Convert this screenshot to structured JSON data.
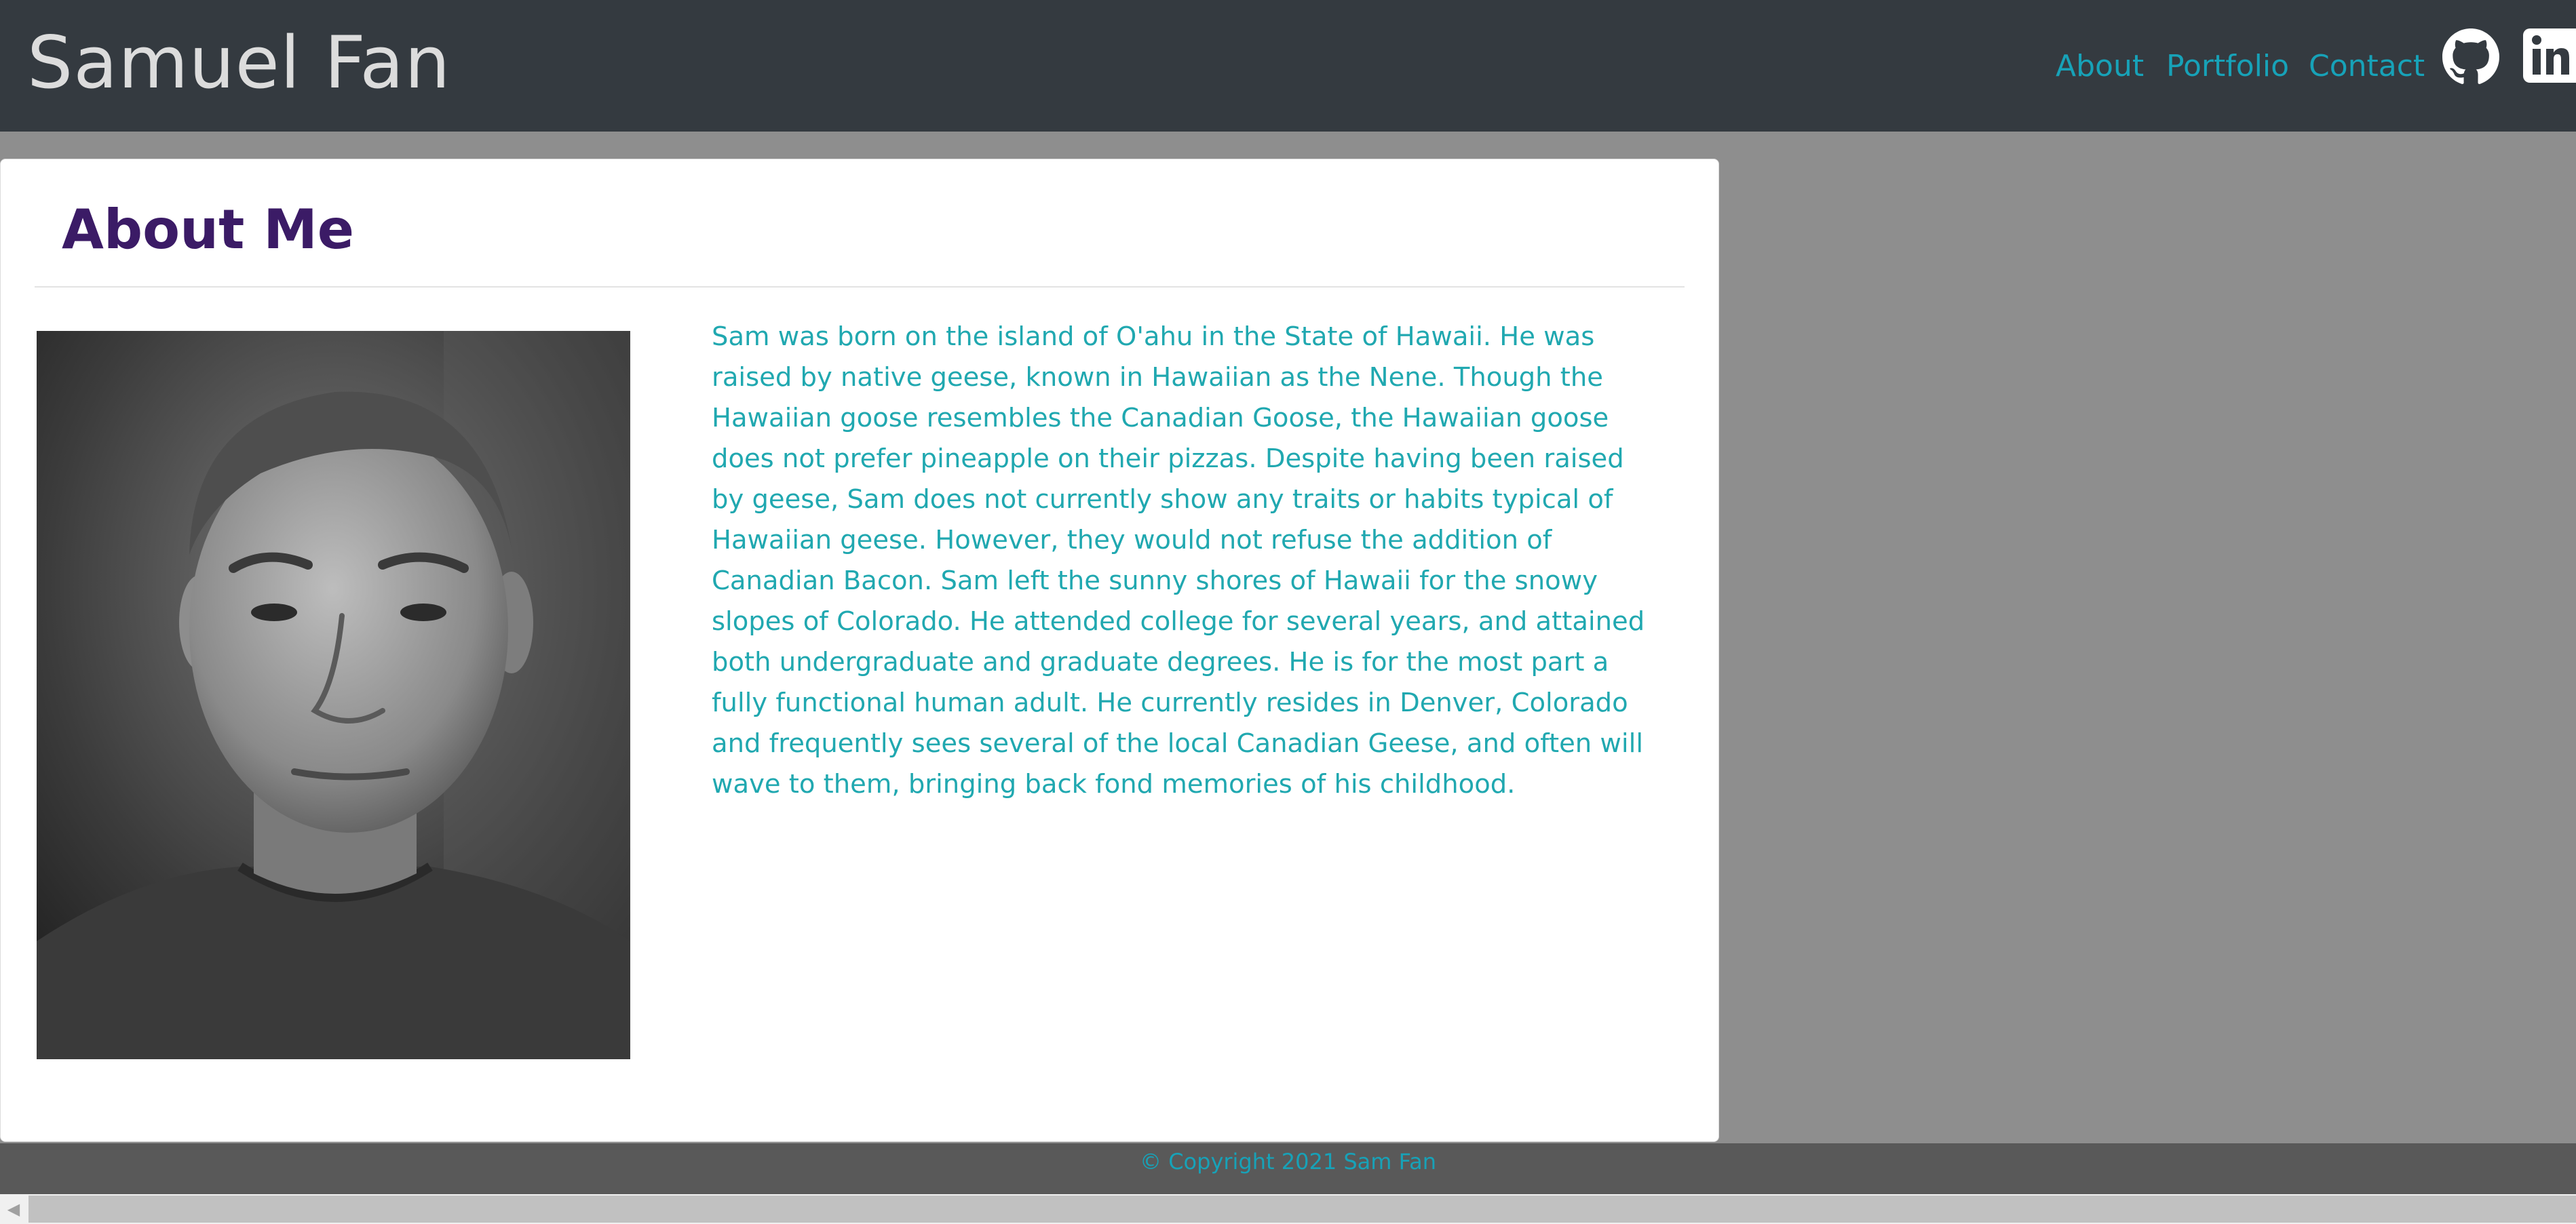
{
  "header": {
    "site_title": "Samuel Fan",
    "nav": [
      {
        "label": "About"
      },
      {
        "label": "Portfolio"
      },
      {
        "label": "Contact"
      }
    ],
    "social": [
      {
        "icon": "github-icon"
      },
      {
        "icon": "linkedin-icon"
      }
    ]
  },
  "about": {
    "heading": "About Me",
    "bio": "Sam was born on the island of O'ahu in the State of Hawaii. He was raised by native geese, known in Hawaiian as the Nene. Though the Hawaiian goose resembles the Canadian Goose, the Hawaiian goose does not prefer pineapple on their pizzas. Despite having been raised by geese, Sam does not currently show any traits or habits typical of Hawaiian geese. However, they would not refuse the addition of Canadian Bacon. Sam left the sunny shores of Hawaii for the snowy slopes of Colorado. He attended college for several years, and attained both undergraduate and graduate degrees. He is for the most part a fully functional human adult. He currently resides in Denver, Colorado and frequently sees several of the local Canadian Geese, and often will wave to them, bringing back fond memories of his childhood."
  },
  "footer": {
    "copyright": "© Copyright 2021 Sam Fan"
  },
  "colors": {
    "header_bg": "#343a40",
    "page_bg": "#8e8e8e",
    "accent": "#17a2b8",
    "heading": "#3b1b66",
    "footer_bg": "#595959"
  }
}
